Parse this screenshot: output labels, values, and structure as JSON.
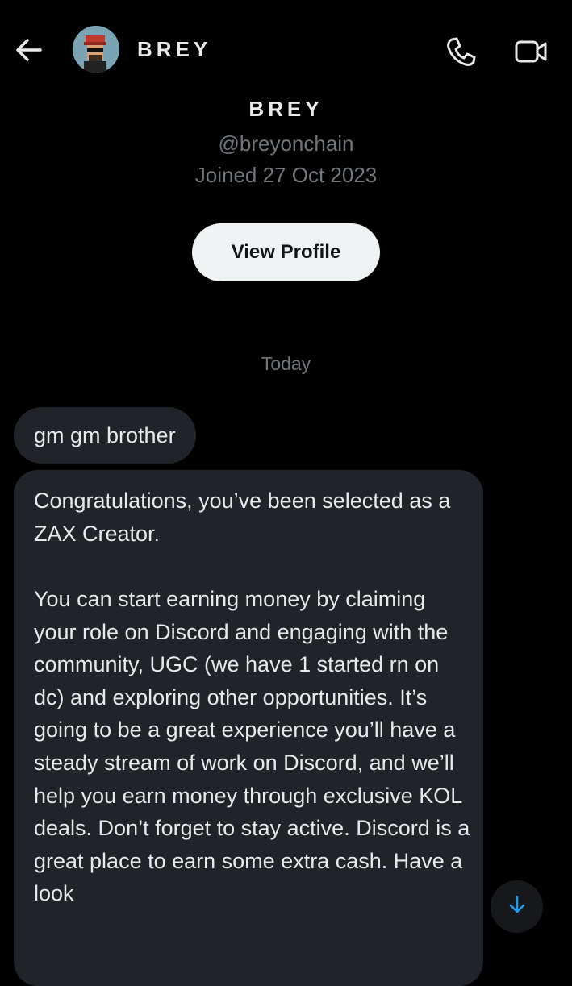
{
  "header": {
    "name": "BREY",
    "back_icon": "arrow-left-icon",
    "call_icon": "phone-icon",
    "video_icon": "video-camera-icon"
  },
  "profile": {
    "name": "BREY",
    "handle": "@breyonchain",
    "joined": "Joined 27 Oct 2023",
    "view_profile_label": "View Profile"
  },
  "conversation": {
    "date_separator": "Today",
    "messages": [
      {
        "text": "gm gm brother"
      },
      {
        "paragraph1": "Congratulations, you’ve been selected as a ZAX Creator.",
        "paragraph2": "You can start earning money by claiming your role on Discord and engaging with the community, UGC (we have 1 started rn on dc) and exploring other opportunities. It’s going to be a great experience you’ll have a steady stream of work on Discord, and we’ll help you earn money through exclusive KOL deals. Don’t forget to stay active. Discord is a great place to earn some extra cash. Have a look"
      }
    ]
  },
  "scroll_button_icon": "arrow-down-icon",
  "colors": {
    "background": "#000000",
    "bubble": "#202327",
    "muted_text": "#71767b",
    "accent": "#1d9bf0"
  }
}
